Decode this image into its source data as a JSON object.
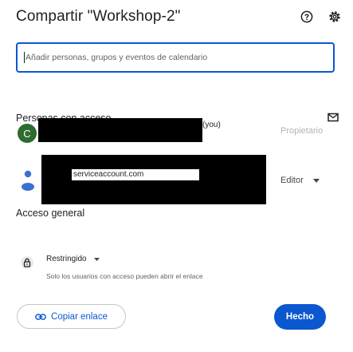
{
  "dialog": {
    "title": "Compartir \"Workshop-2\"",
    "help_icon": "help-circle-icon",
    "settings_icon": "gear-icon"
  },
  "search": {
    "placeholder": "Añadir personas, grupos y eventos de calendario"
  },
  "people_section": {
    "label": "Personas con acceso",
    "mail_icon": "mail-icon",
    "people": [
      {
        "avatar_letter": "C",
        "avatar_color": "#2e6b2e",
        "name_suffix": "(you)",
        "role": "Propietario"
      },
      {
        "avatar_icon": "person-icon",
        "avatar_color": "#3b6fd0",
        "email_suffix": "serviceaccount.com",
        "role": "Editor"
      }
    ]
  },
  "general_access": {
    "label": "Acceso general",
    "lock_icon": "lock-icon",
    "setting": "Restringido",
    "helper": "Solo los usuarios con acceso pueden abrir el enlace"
  },
  "footer": {
    "copy_link_label": "Copiar enlace",
    "done_label": "Hecho"
  },
  "colors": {
    "accent": "#0b57d0",
    "owner_avatar": "#2e6b2e"
  }
}
